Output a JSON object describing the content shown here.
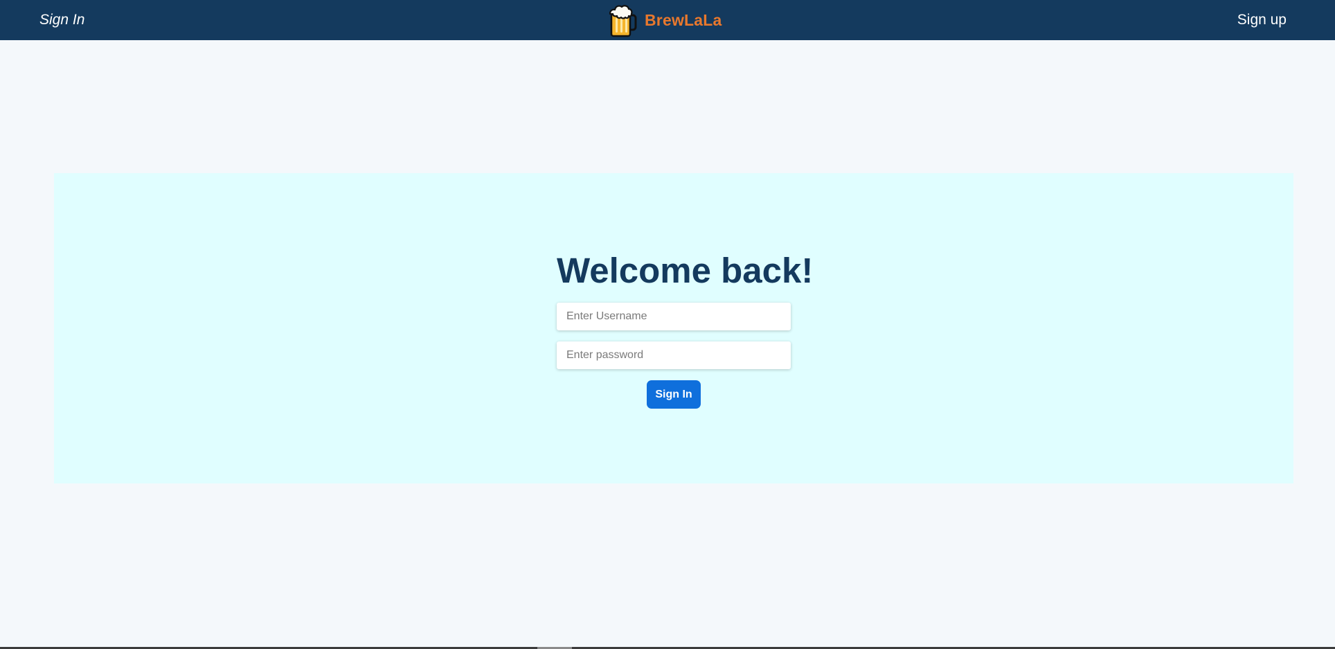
{
  "nav": {
    "signin_label": "Sign In",
    "signup_label": "Sign up",
    "brand_name": "BrewLaLa",
    "brand_logo_icon": "beer-mug-icon",
    "background_color": "#143a5e",
    "brand_color": "#e8782d"
  },
  "main": {
    "title": "Welcome back!",
    "title_color": "#143a5e",
    "username_placeholder": "Enter Username",
    "username_value": "",
    "password_placeholder": "Enter password",
    "password_value": "",
    "submit_label": "Sign In",
    "submit_color": "#0f6fdc",
    "panel_color": "#e0feff"
  }
}
